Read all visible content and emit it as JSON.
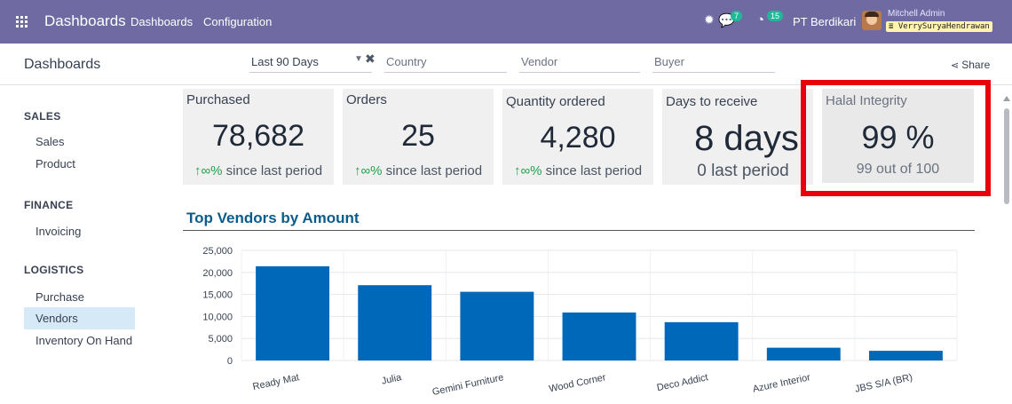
{
  "navbar": {
    "brand": "Dashboards",
    "menu": [
      "Dashboards",
      "Configuration"
    ],
    "chat_count": "7",
    "activity_count": "15",
    "company": "PT Berdikari",
    "user_name": "Mitchell Admin",
    "db_name": "VerrySuryaHendrawan"
  },
  "control": {
    "title": "Dashboards",
    "date_filter": "Last 90 Days",
    "country_placeholder": "Country",
    "vendor_placeholder": "Vendor",
    "buyer_placeholder": "Buyer",
    "share_label": "Share"
  },
  "sidebar": {
    "sections": [
      {
        "title": "SALES",
        "items": [
          "Sales",
          "Product"
        ]
      },
      {
        "title": "FINANCE",
        "items": [
          "Invoicing"
        ]
      },
      {
        "title": "LOGISTICS",
        "items": [
          "Purchase",
          "Vendors",
          "Inventory On Hand"
        ]
      }
    ],
    "active_item": "Vendors"
  },
  "kpis": [
    {
      "title": "Purchased",
      "value": "78,682",
      "arrow": "↑",
      "pct": "∞%",
      "sub": " since last period"
    },
    {
      "title": "Orders",
      "value": "25",
      "arrow": "↑",
      "pct": "∞%",
      "sub": " since last period"
    },
    {
      "title": "Quantity ordered",
      "value": "4,280",
      "arrow": "↑",
      "pct": "∞%",
      "sub": " since last period"
    },
    {
      "title": "Days to receive",
      "value": "8 days",
      "sub": "0 last period"
    },
    {
      "title": "Halal Integrity",
      "value": "99 %",
      "sub": "99 out of 100"
    }
  ],
  "colors": {
    "navbar": "#6f6aa2",
    "bar": "#0068b8",
    "chart_title": "#0b5c8c",
    "highlight": "#e8000c",
    "trend_up": "#21a04b"
  },
  "chart_data": {
    "type": "bar",
    "title": "Top Vendors by Amount",
    "categories": [
      "Ready Mat",
      "Julia",
      "Gemini Furniture",
      "Wood Corner",
      "Deco Addict",
      "Azure Interior",
      "JBS S/A (BR)"
    ],
    "values": [
      21400,
      17100,
      15600,
      10900,
      8700,
      2900,
      2200
    ],
    "ylim": [
      0,
      25000
    ],
    "yticks": [
      "0",
      "5,000",
      "10,000",
      "15,000",
      "20,000",
      "25,000"
    ],
    "grid": true
  }
}
